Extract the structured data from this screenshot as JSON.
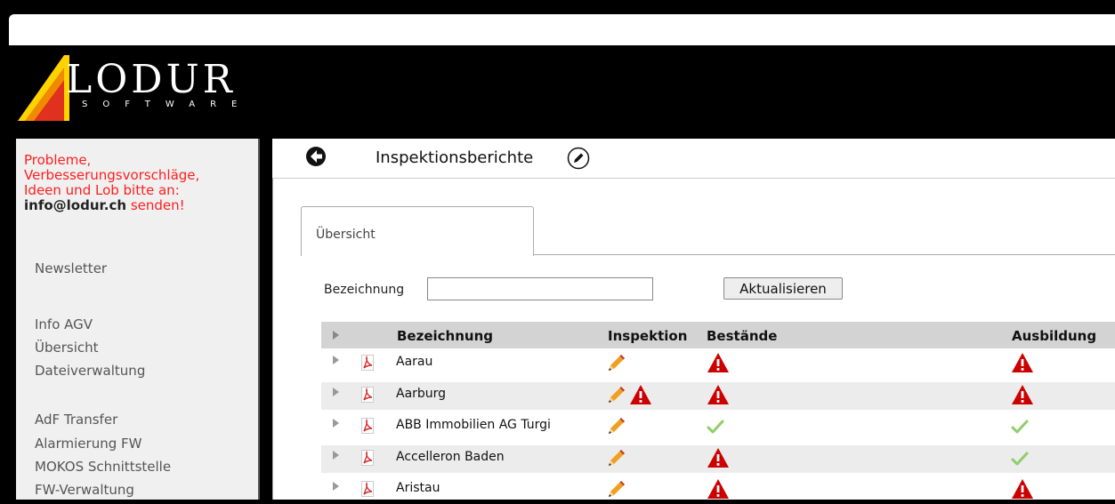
{
  "logo": {
    "main": "LODUR",
    "sub": "SOFTWARE"
  },
  "contact": {
    "line1": "Probleme,",
    "line2": "Verbesserungsvorschläge,",
    "line3": "Ideen und Lob bitte an:",
    "email": "info@lodur.ch",
    "send": " senden!"
  },
  "nav": {
    "newsletter": "Newsletter",
    "info_agv": "Info AGV",
    "uebersicht": "Übersicht",
    "dateiverwaltung": "Dateiverwaltung",
    "adf_transfer": "AdF Transfer",
    "alarmierung": "Alarmierung FW",
    "mokos": "MOKOS Schnittstelle",
    "fw_verwaltung": "FW-Verwaltung"
  },
  "page": {
    "title": "Inspektionsberichte"
  },
  "tab": {
    "label": "Übersicht"
  },
  "filter": {
    "label": "Bezeichnung",
    "value": "",
    "placeholder": "",
    "button": "Aktualisieren"
  },
  "table": {
    "headers": {
      "name": "Bezeichnung",
      "inspektion": "Inspektion",
      "bestaende": "Bestände",
      "ausbildung": "Ausbildung"
    },
    "rows": [
      {
        "name": "Aarau",
        "inspektion": [
          "pencil"
        ],
        "bestaende": "warning",
        "ausbildung": "warning"
      },
      {
        "name": "Aarburg",
        "inspektion": [
          "pencil",
          "warning"
        ],
        "bestaende": "warning",
        "ausbildung": "warning"
      },
      {
        "name": "ABB Immobilien AG Turgi",
        "inspektion": [
          "pencil"
        ],
        "bestaende": "check",
        "ausbildung": "check"
      },
      {
        "name": "Accelleron Baden",
        "inspektion": [
          "pencil"
        ],
        "bestaende": "warning",
        "ausbildung": "check"
      },
      {
        "name": "Aristau",
        "inspektion": [
          "pencil"
        ],
        "bestaende": "warning",
        "ausbildung": "warning"
      }
    ]
  },
  "colors": {
    "warning": "#cc0000",
    "check": "#8fce6a",
    "contact_red": "#ff1e1e",
    "logo_yellow": "#ffd200",
    "logo_orange": "#f08a00",
    "logo_red": "#e0301e"
  }
}
